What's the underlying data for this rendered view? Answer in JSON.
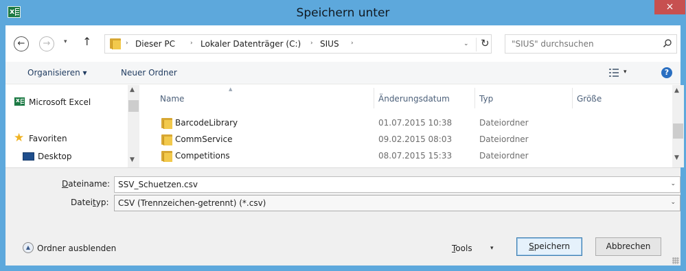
{
  "window": {
    "title": "Speichern unter",
    "close_glyph": "×",
    "app_icon": "excel-icon"
  },
  "nav": {
    "back_glyph": "←",
    "forward_glyph": "→",
    "recent_glyph": "▾",
    "up_glyph": "↑"
  },
  "address": {
    "crumbs": [
      "Dieser PC",
      "Lokaler Datenträger (C:)",
      "SIUS"
    ],
    "separator": "›",
    "dropdown_glyph": "⌄",
    "refresh_glyph": "↻"
  },
  "search": {
    "placeholder": "\"SIUS\" durchsuchen"
  },
  "toolbar": {
    "organize_label": "Organisieren ▾",
    "new_folder_label": "Neuer Ordner",
    "view_dd_glyph": "▾",
    "help_glyph": "?"
  },
  "navpane": {
    "items": [
      {
        "label": "Microsoft Excel",
        "icon": "excel-icon"
      },
      {
        "label": "Favoriten",
        "icon": "star-icon"
      },
      {
        "label": "Desktop",
        "icon": "desktop-icon"
      }
    ]
  },
  "files": {
    "columns": [
      "Name",
      "Änderungsdatum",
      "Typ",
      "Größe"
    ],
    "rows": [
      {
        "name": "BarcodeLibrary",
        "date": "01.07.2015 10:38",
        "type": "Dateiordner"
      },
      {
        "name": "CommService",
        "date": "09.02.2015 08:03",
        "type": "Dateiordner"
      },
      {
        "name": "Competitions",
        "date": "08.07.2015 15:33",
        "type": "Dateiordner"
      }
    ]
  },
  "save": {
    "filename_label_u": "D",
    "filename_label_rest": "ateiname:",
    "filename_value": "SSV_Schuetzen.csv",
    "filetype_label_pre": "Datei",
    "filetype_label_u": "t",
    "filetype_label_rest": "yp:",
    "filetype_value": "CSV (Trennzeichen-getrennt) (*.csv)",
    "dropdown_glyph": "⌄",
    "hide_folders_label": "Ordner ausblenden",
    "hide_folders_glyph": "▲",
    "tools_u": "T",
    "tools_rest": "ools",
    "tools_dd": "▾",
    "save_u": "S",
    "save_rest": "peichern",
    "cancel_label": "Abbrechen"
  }
}
